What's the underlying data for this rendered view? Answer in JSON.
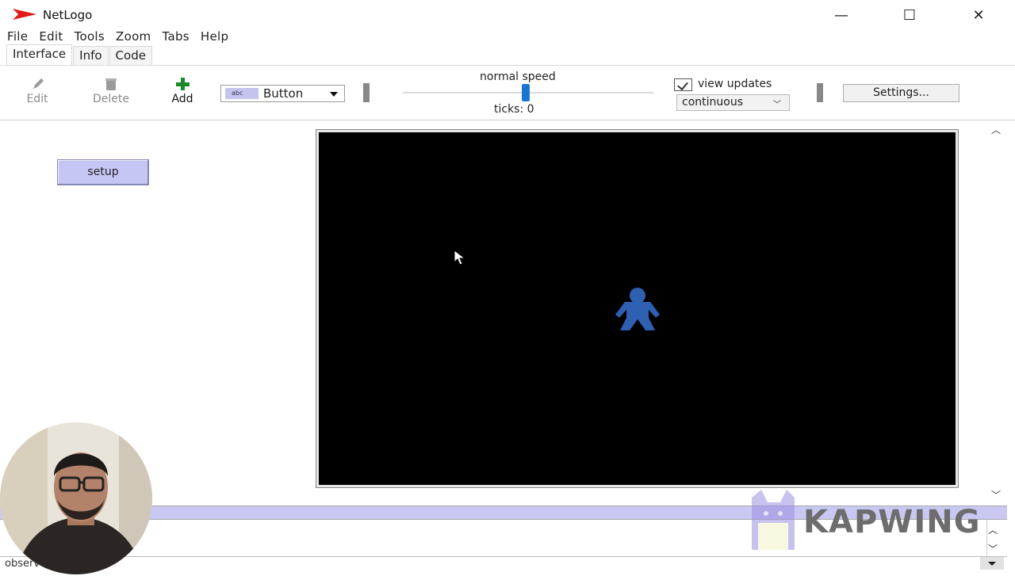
{
  "window": {
    "title": "NetLogo",
    "controls": {
      "minimize": "—",
      "maximize": "☐",
      "close": "✕"
    }
  },
  "menu": [
    "File",
    "Edit",
    "Tools",
    "Zoom",
    "Tabs",
    "Help"
  ],
  "tabs": [
    {
      "label": "Interface",
      "active": true
    },
    {
      "label": "Info",
      "active": false
    },
    {
      "label": "Code",
      "active": false
    }
  ],
  "toolbar": {
    "edit_label": "Edit",
    "delete_label": "Delete",
    "add_label": "Add",
    "widget_type": "Button",
    "widget_icon_text": "abc",
    "speed_label": "normal speed",
    "speed_fraction": 0.5,
    "ticks_label": "ticks: 0",
    "view_updates_label": "view updates",
    "view_updates_checked": true,
    "update_mode": "continuous",
    "settings_label": "Settings..."
  },
  "interface": {
    "setup_button_label": "setup"
  },
  "view": {
    "background": "#000000",
    "turtle_color": "#2e5fb0"
  },
  "command_center": {
    "prompt": "observer>",
    "input_value": ""
  },
  "watermark": {
    "text": "KAPWING"
  },
  "colors": {
    "accent": "#1876d2",
    "button_bg": "#c6c6f5",
    "command_bar": "#c8c8f2",
    "logo_red": "#e01b1b"
  }
}
